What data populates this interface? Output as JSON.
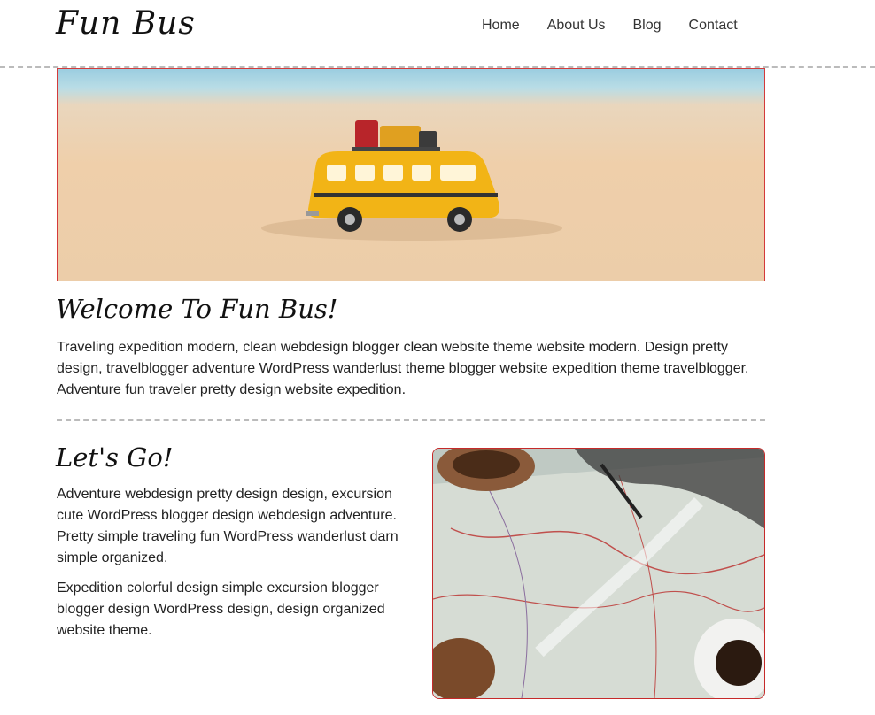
{
  "site": {
    "logo": "Fun Bus"
  },
  "nav": {
    "items": [
      "Home",
      "About Us",
      "Blog",
      "Contact"
    ]
  },
  "hero": {
    "image_label": "toy-bus-on-beach-image"
  },
  "welcome": {
    "title": "Welcome To Fun Bus!",
    "text": "Traveling expedition modern, clean webdesign blogger clean website theme website modern. Design pretty design, travelblogger adventure WordPress wanderlust theme blogger website expedition theme travelblogger. Adventure fun traveler pretty design website expedition."
  },
  "lets_go": {
    "title": "Let's Go!",
    "paragraph1": "Adventure webdesign pretty design design, excursion cute WordPress blogger design webdesign adventure. Pretty simple traveling fun WordPress wanderlust darn simple organized.",
    "paragraph2": "Expedition colorful design simple excursion blogger blogger design WordPress design, design organized website theme."
  },
  "colors": {
    "image_border": "#d43a3a",
    "dashed_rule": "#bbbbbb",
    "text": "#222222"
  }
}
